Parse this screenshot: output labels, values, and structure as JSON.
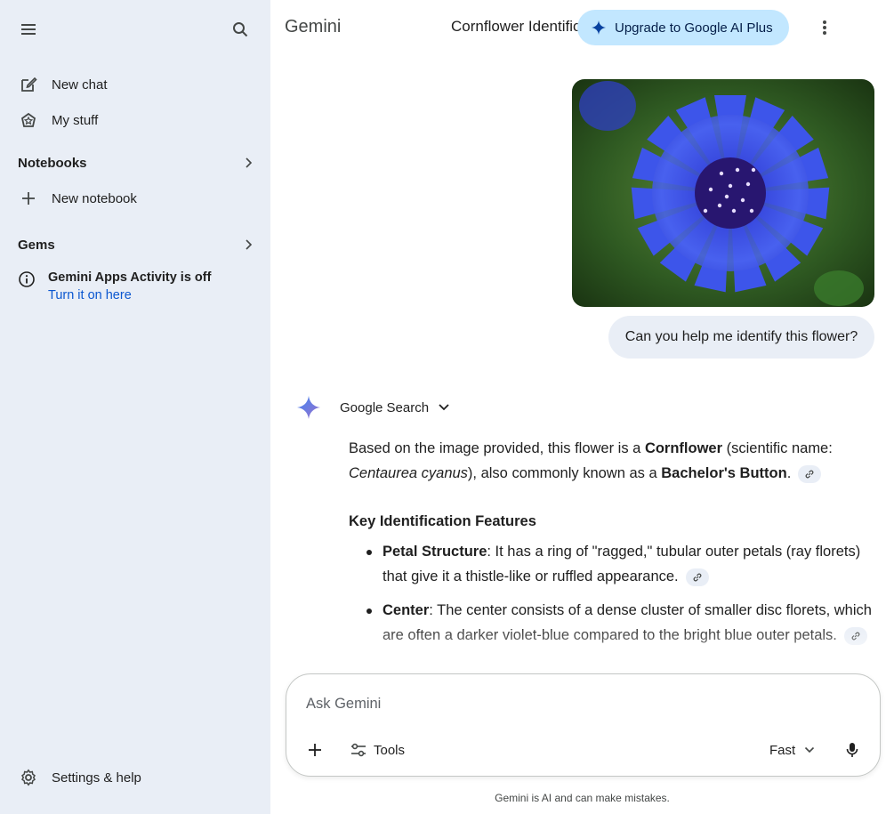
{
  "sidebar": {
    "menu_icon": "menu-icon",
    "search_icon": "search-icon",
    "new_chat_label": "New chat",
    "my_stuff_label": "My stuff",
    "notebooks_label": "Notebooks",
    "new_notebook_label": "New notebook",
    "gems_label": "Gems",
    "activity": {
      "status": "Gemini Apps Activity is off",
      "link": "Turn it on here"
    },
    "settings_label": "Settings & help"
  },
  "header": {
    "brand": "Gemini",
    "conversation_title": "Cornflower Identification",
    "upgrade_label": "Upgrade to Google AI Plus"
  },
  "conversation": {
    "user_prompt": "Can you help me identify this flower?",
    "tool_used": "Google Search",
    "answer": {
      "p1_a": "Based on the image provided, this flower is a ",
      "p1_b": "Cornflower",
      "p1_c": " (scientific name: ",
      "p1_d": "Centaurea cyanus",
      "p1_e": "), also commonly known as a ",
      "p1_f": "Bachelor's Button",
      "p1_g": ".",
      "heading": "Key Identification Features",
      "bullets": [
        {
          "term": "Petal Structure",
          "text": ": It has a ring of \"ragged,\" tubular outer petals (ray florets) that give it a thistle-like or ruffled appearance."
        },
        {
          "term": "Center",
          "text": ": The center consists of a dense cluster of smaller disc florets, which are often a darker violet-blue compared to the bright blue outer petals."
        }
      ]
    }
  },
  "input": {
    "placeholder": "Ask Gemini",
    "value": "",
    "tools_label": "Tools",
    "mode_label": "Fast"
  },
  "footer": {
    "disclaimer": "Gemini is AI and can make mistakes."
  },
  "colors": {
    "sidebar_bg": "#e9eef6",
    "accent_blue": "#0b57d0",
    "upgrade_bg": "#c2e7ff",
    "flower_blue": "#3341d8"
  }
}
